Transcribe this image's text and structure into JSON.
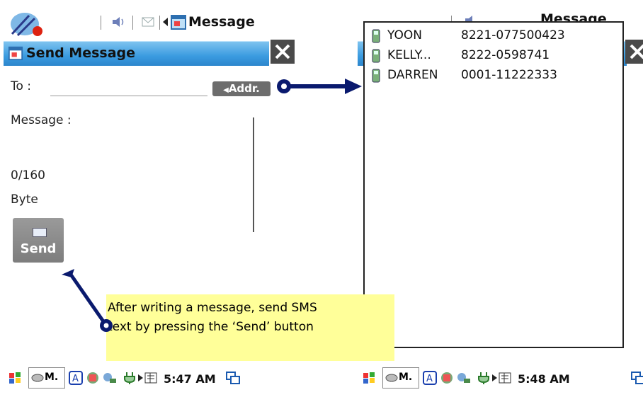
{
  "left_screen": {
    "status_title": "Message",
    "window_title": "Send Message",
    "to_label": "To :",
    "addr_button": "Addr.",
    "message_label": "Message :",
    "byte_count": "0/160",
    "byte_unit": "Byte",
    "send_button": "Send",
    "taskbar_app": "M.",
    "time": "5:47 AM"
  },
  "right_screen": {
    "status_title": "Message",
    "contacts": [
      {
        "name": "YOON",
        "number": "8221-077500423"
      },
      {
        "name": "KELLY...",
        "number": "8222-0598741"
      },
      {
        "name": "DARREN",
        "number": "0001-11222333"
      }
    ],
    "taskbar_app": "M.",
    "time": "5:48 AM"
  },
  "annotation": {
    "line1": "After writing a message, send SMS",
    "line2": "text by pressing the ‘Send’ button"
  },
  "colors": {
    "title_bar": "#3a9be0",
    "button_gray": "#6d6d6d",
    "arrow": "#0a1a6e",
    "note_bg": "#ffff99"
  }
}
